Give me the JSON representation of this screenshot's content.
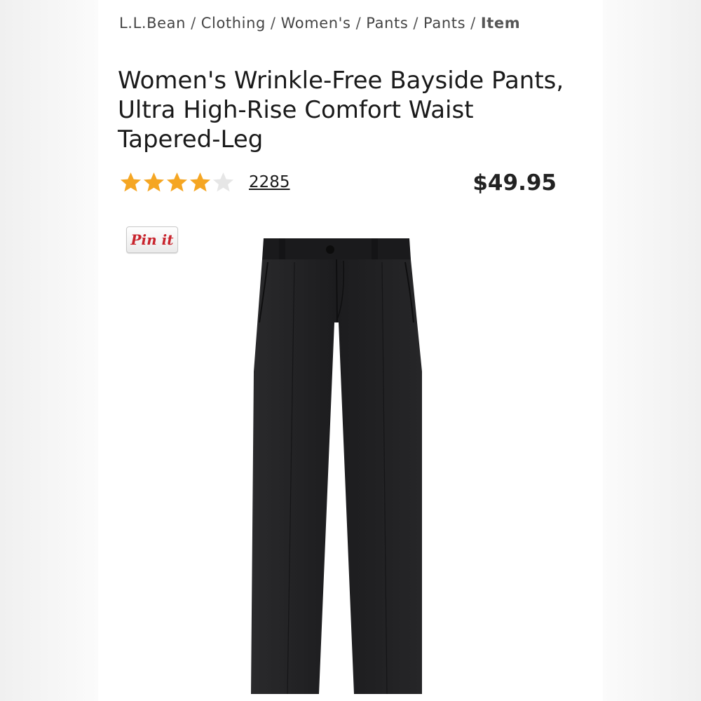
{
  "breadcrumb": {
    "items": [
      "L.L.Bean",
      "Clothing",
      "Women's",
      "Pants",
      "Pants"
    ],
    "current": "Item",
    "separator": "/"
  },
  "product": {
    "title": "Women's Wrinkle-Free Bayside Pants, Ultra High-Rise Comfort Waist Tapered-Leg",
    "rating": 4,
    "rating_max": 5,
    "review_count": "2285",
    "price": "$49.95",
    "image_icon": "black-pants-image"
  },
  "pinit": {
    "label": "Pin it"
  },
  "colors": {
    "star_filled": "#f5a623",
    "star_empty": "#e6e6e6",
    "pinit_red": "#c8232c",
    "pants": "#1e1e20"
  }
}
